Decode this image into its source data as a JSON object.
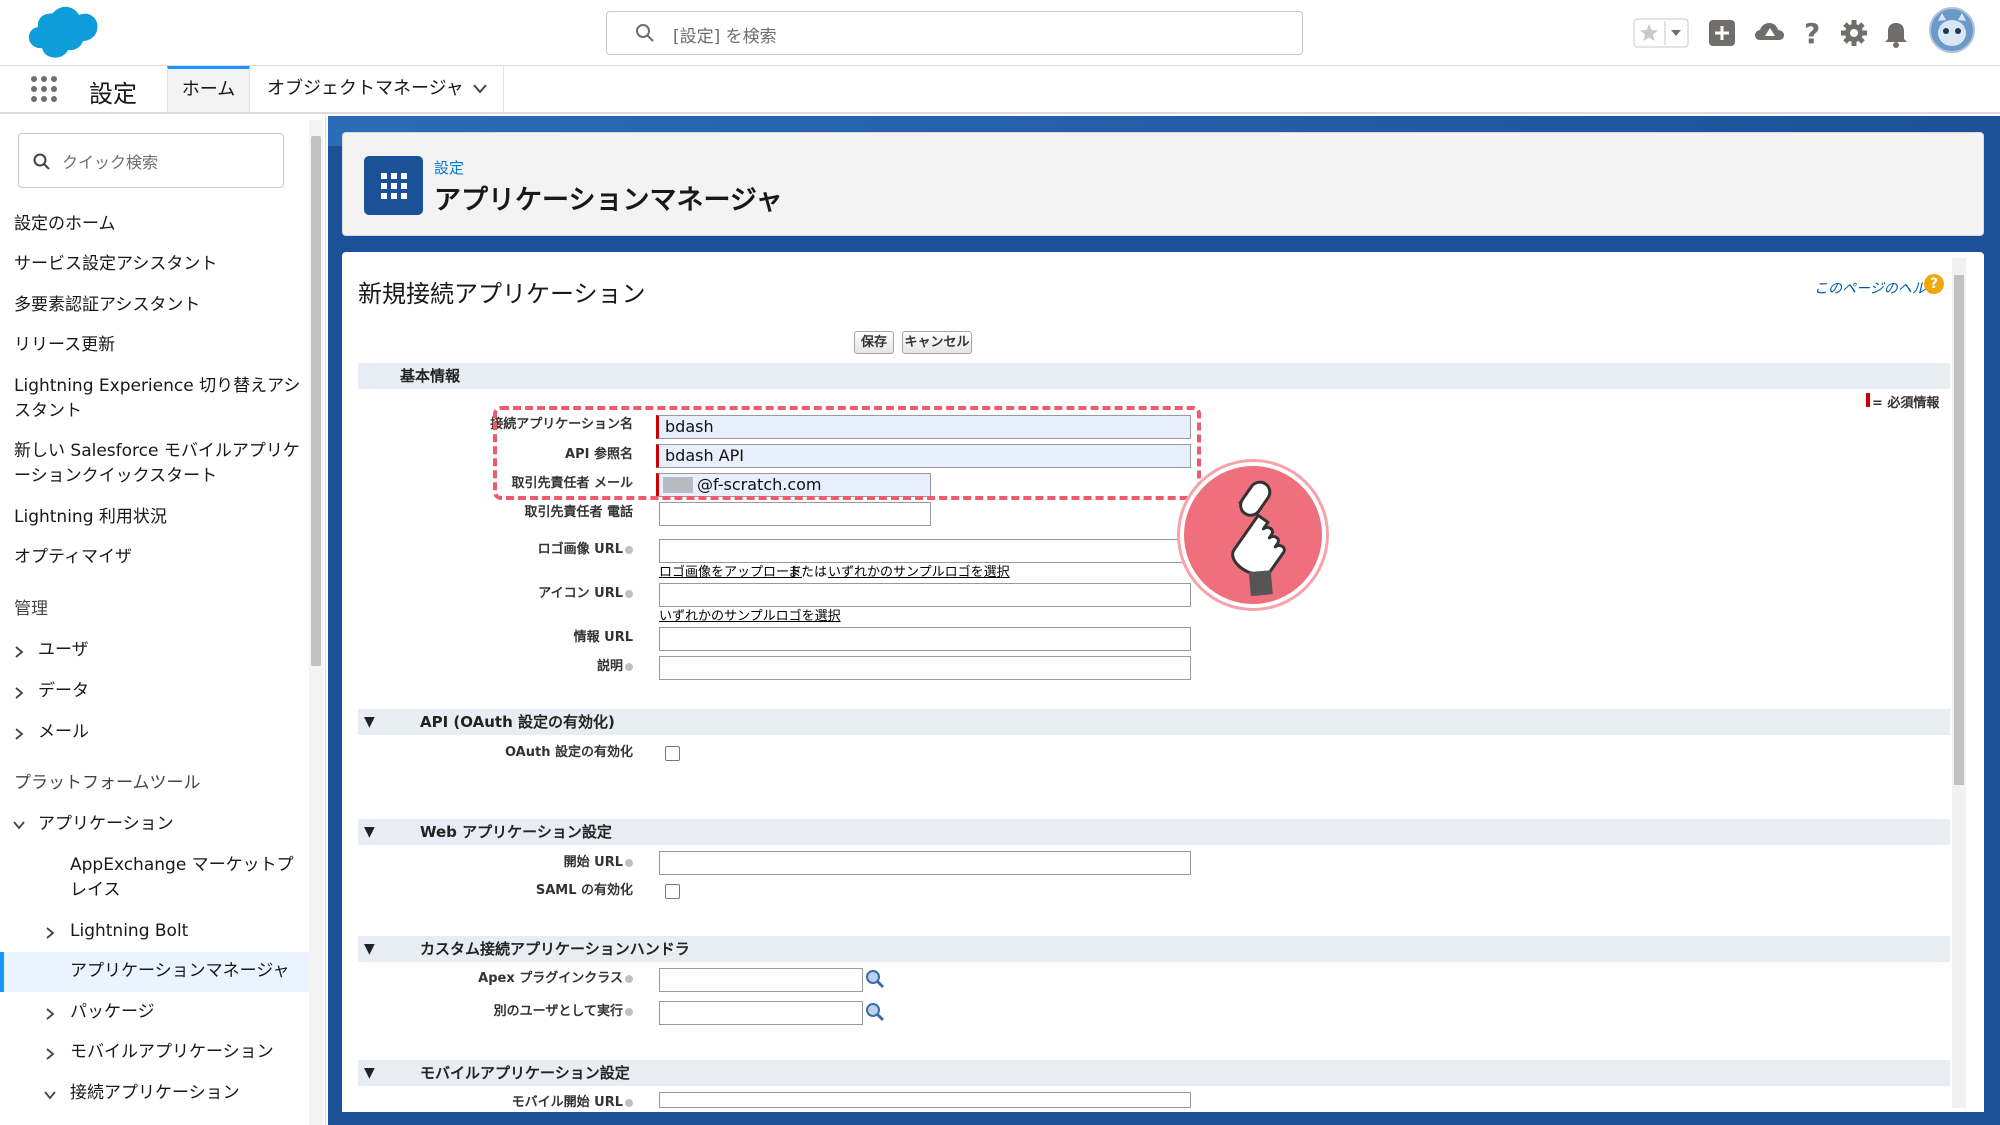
{
  "search": {
    "placeholder": "[設定] を検索"
  },
  "nav": {
    "title": "設定",
    "tabs": [
      "ホーム",
      "オブジェクトマネージャ"
    ]
  },
  "sidebar": {
    "quick_find_placeholder": "クイック検索",
    "items": [
      "設定のホーム",
      "サービス設定アシスタント",
      "多要素認証アシスタント",
      "リリース更新",
      "Lightning Experience 切り替えアシスタント",
      "新しい Salesforce モバイルアプリケーションクイックスタート",
      "Lightning 利用状況",
      "オプティマイザ"
    ],
    "admin_heading": "管理",
    "admin_items": [
      "ユーザ",
      "データ",
      "メール"
    ],
    "platform_heading": "プラットフォームツール",
    "apps_label": "アプリケーション",
    "app_children": [
      "AppExchange マーケットプレイス",
      "Lightning Bolt",
      "アプリケーションマネージャ",
      "パッケージ",
      "モバイルアプリケーション",
      "接続アプリケーション"
    ]
  },
  "header": {
    "breadcrumb": "設定",
    "title": "アプリケーションマネージャ"
  },
  "form": {
    "title": "新規接続アプリケーション",
    "help_link": "このページのヘルプ",
    "help_icon": "?",
    "save_label": "保存",
    "cancel_label": "キャンセル",
    "basic_section": "基本情報",
    "required_note": "= 必須情報",
    "fields": {
      "app_name": {
        "label": "接続アプリケーション名",
        "value": "bdash"
      },
      "api_name": {
        "label": "API 参照名",
        "value": "bdash API"
      },
      "contact_email": {
        "label": "取引先責任者 メール",
        "value": "@f-scratch.com"
      },
      "contact_phone": {
        "label": "取引先責任者 電話",
        "value": ""
      },
      "logo_url": {
        "label": "ロゴ画像 URL",
        "value": ""
      },
      "icon_url": {
        "label": "アイコン URL",
        "value": ""
      },
      "info_url": {
        "label": "情報 URL",
        "value": ""
      },
      "description": {
        "label": "説明",
        "value": ""
      }
    },
    "logo_upload_link": "ロゴ画像をアップロード",
    "logo_or": "または",
    "sample_logo_link": "いずれかのサンプルロゴを選択",
    "icon_sample_link": "いずれかのサンプルロゴを選択",
    "api_section": "API (OAuth 設定の有効化)",
    "oauth_label": "OAuth 設定の有効化",
    "web_section": "Web アプリケーション設定",
    "start_url_label": "開始 URL",
    "saml_label": "SAML の有効化",
    "handler_section": "カスタム接続アプリケーションハンドラ",
    "apex_label": "Apex プラグインクラス",
    "run_as_label": "別のユーザとして実行",
    "mobile_section": "モバイルアプリケーション設定",
    "mobile_start_label": "モバイル開始 URL"
  },
  "colors": {
    "brand": "#0176d3",
    "accent": "#1b96ff",
    "highlight": "#ef5b6c",
    "header_band": "#1b5297"
  }
}
